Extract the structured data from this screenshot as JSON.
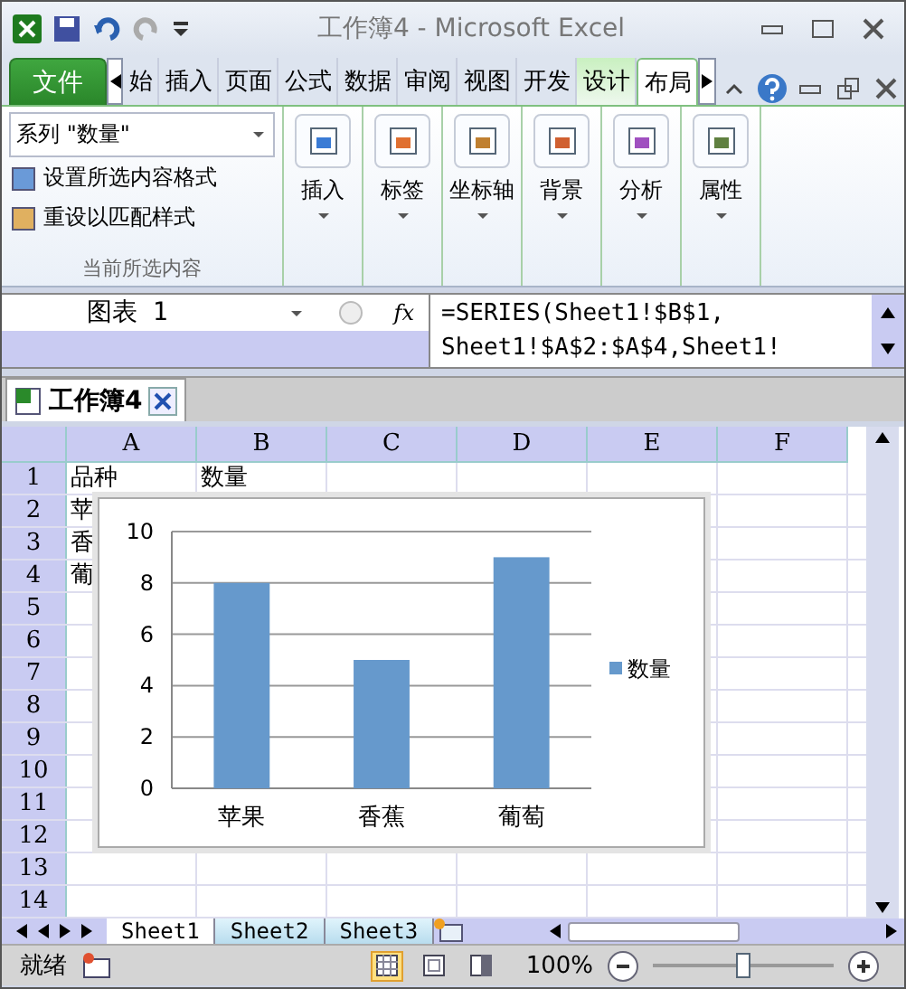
{
  "window": {
    "title": "工作簿4 - Microsoft Excel"
  },
  "ribbon_tabs": [
    {
      "label": "文件",
      "kind": "file",
      "selected": false
    },
    {
      "label": "始",
      "kind": "tab",
      "selected": false
    },
    {
      "label": "插入",
      "kind": "tab",
      "selected": false
    },
    {
      "label": "页面",
      "kind": "tab",
      "selected": false
    },
    {
      "label": "公式",
      "kind": "tab",
      "selected": false
    },
    {
      "label": "数据",
      "kind": "tab",
      "selected": false
    },
    {
      "label": "审阅",
      "kind": "tab",
      "selected": false
    },
    {
      "label": "视图",
      "kind": "tab",
      "selected": false
    },
    {
      "label": "开发",
      "kind": "tab",
      "selected": false
    },
    {
      "label": "设计",
      "kind": "context",
      "selected": false
    },
    {
      "label": "布局",
      "kind": "context",
      "selected": true
    }
  ],
  "current_selection": {
    "dropdown": "系列 \"数量\"",
    "commands": [
      "设置所选内容格式",
      "重设以匹配样式"
    ],
    "group_label": "当前所选内容"
  },
  "ribbon_buttons": [
    {
      "label": "插入",
      "kind": "insert"
    },
    {
      "label": "标签",
      "kind": "labels"
    },
    {
      "label": "坐标轴",
      "kind": "axes"
    },
    {
      "label": "背景",
      "kind": "background"
    },
    {
      "label": "分析",
      "kind": "analysis"
    },
    {
      "label": "属性",
      "kind": "properties"
    }
  ],
  "formula_bar": {
    "name_box": "图表 1",
    "fx_label": "fx",
    "formula": [
      "=SERIES(Sheet1!$B$1,",
      "Sheet1!$A$2:$A$4,Sheet1!"
    ]
  },
  "workbook_tab": {
    "title": "工作簿4"
  },
  "sheet": {
    "columns": [
      "A",
      "B",
      "C",
      "D",
      "E",
      "F"
    ],
    "rows": [
      {
        "header": "1",
        "cells": [
          "品种",
          "数量"
        ]
      },
      {
        "header": "2",
        "cells": [
          "苹"
        ]
      },
      {
        "header": "3",
        "cells": [
          "香"
        ]
      },
      {
        "header": "4",
        "cells": [
          "葡"
        ]
      },
      {
        "header": "5",
        "cells": []
      },
      {
        "header": "6",
        "cells": []
      },
      {
        "header": "7",
        "cells": []
      },
      {
        "header": "8",
        "cells": []
      },
      {
        "header": "9",
        "cells": []
      },
      {
        "header": "10",
        "cells": []
      },
      {
        "header": "11",
        "cells": []
      },
      {
        "header": "12",
        "cells": []
      },
      {
        "header": "13",
        "cells": []
      },
      {
        "header": "14",
        "cells": []
      }
    ]
  },
  "chart": {
    "chart_data": {
      "type": "bar",
      "categories": [
        "苹果",
        "香蕉",
        "葡萄"
      ],
      "series": [
        {
          "name": "数量",
          "color": "#6699cc",
          "values": [
            8,
            5,
            9
          ]
        }
      ],
      "ylim": [
        0,
        10
      ],
      "yticks": [
        0,
        2,
        4,
        6,
        8,
        10
      ],
      "grid": true
    }
  },
  "sheet_tabs": [
    {
      "label": "Sheet1",
      "selected": true
    },
    {
      "label": "Sheet2",
      "selected": false
    },
    {
      "label": "Sheet3",
      "selected": false
    }
  ],
  "status_bar": {
    "status": "就绪",
    "zoom": "100%",
    "zoom_slider": {
      "level": 0.5
    },
    "views": [
      {
        "kind": "normal",
        "selected": true
      },
      {
        "kind": "layout",
        "selected": false
      },
      {
        "kind": "pagebreak",
        "selected": false
      }
    ]
  }
}
